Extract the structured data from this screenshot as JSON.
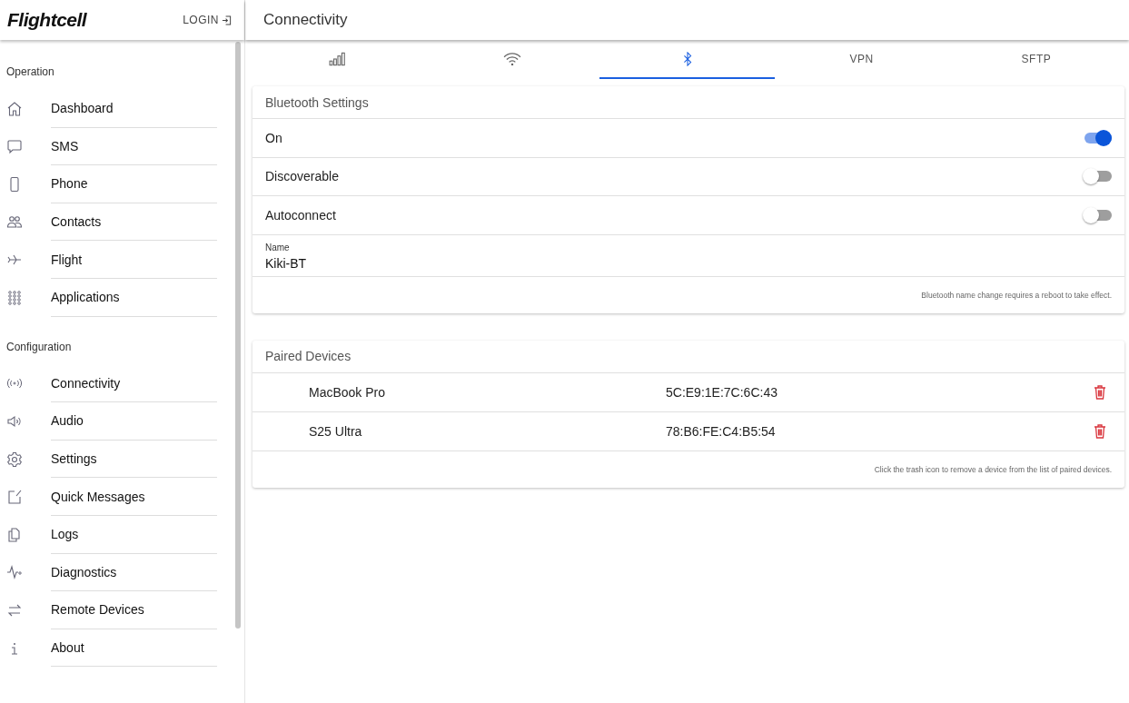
{
  "sidebar": {
    "logo": "Flightcell",
    "login": "LOGIN",
    "sections": [
      {
        "title": "Operation",
        "items": [
          {
            "label": "Dashboard",
            "kind": "home"
          },
          {
            "label": "SMS",
            "kind": "chat"
          },
          {
            "label": "Phone",
            "kind": "phone"
          },
          {
            "label": "Contacts",
            "kind": "people"
          },
          {
            "label": "Flight",
            "kind": "plane"
          },
          {
            "label": "Applications",
            "kind": "grid"
          }
        ]
      },
      {
        "title": "Configuration",
        "items": [
          {
            "label": "Connectivity",
            "kind": "radio"
          },
          {
            "label": "Audio",
            "kind": "speaker"
          },
          {
            "label": "Settings",
            "kind": "gear"
          },
          {
            "label": "Quick Messages",
            "kind": "edit"
          },
          {
            "label": "Logs",
            "kind": "copy"
          },
          {
            "label": "Diagnostics",
            "kind": "pulse"
          },
          {
            "label": "Remote Devices",
            "kind": "swap"
          },
          {
            "label": "About",
            "kind": "info"
          }
        ]
      }
    ]
  },
  "header": {
    "title": "Connectivity"
  },
  "tabs": [
    {
      "kind": "cellular",
      "selected": false
    },
    {
      "kind": "wifi",
      "selected": false
    },
    {
      "kind": "bluetooth",
      "selected": true
    },
    {
      "kind": "text",
      "label": "VPN",
      "selected": false
    },
    {
      "kind": "text",
      "label": "SFTP",
      "selected": false
    }
  ],
  "bluetooth_settings": {
    "title": "Bluetooth Settings",
    "toggles": [
      {
        "label": "On",
        "on": true
      },
      {
        "label": "Discoverable",
        "on": false
      },
      {
        "label": "Autoconnect",
        "on": false
      }
    ],
    "name_field": {
      "label": "Name",
      "value": "Kiki-BT"
    },
    "note": "Bluetooth name change requires a reboot to take effect."
  },
  "paired_devices": {
    "title": "Paired Devices",
    "devices": [
      {
        "name": "MacBook Pro",
        "address": "5C:E9:1E:7C:6C:43"
      },
      {
        "name": "S25 Ultra",
        "address": "78:B6:FE:C4:B5:54"
      }
    ],
    "note": "Click the trash icon to remove a device from the list of paired devices."
  }
}
